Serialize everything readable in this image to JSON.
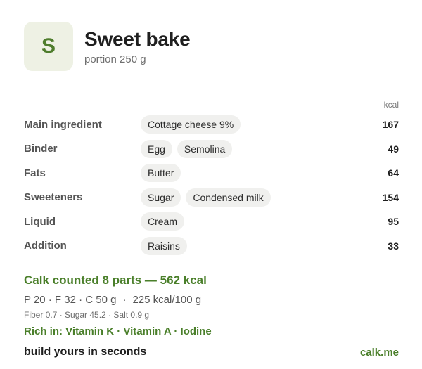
{
  "header": {
    "avatar_letter": "S",
    "title": "Sweet bake",
    "subtitle": "portion 250 g"
  },
  "table": {
    "unit_label": "kcal",
    "rows": [
      {
        "label": "Main ingredient",
        "chips": [
          "Cottage cheese 9%"
        ],
        "value": "167"
      },
      {
        "label": "Binder",
        "chips": [
          "Egg",
          "Semolina"
        ],
        "value": "49"
      },
      {
        "label": "Fats",
        "chips": [
          "Butter"
        ],
        "value": "64"
      },
      {
        "label": "Sweeteners",
        "chips": [
          "Sugar",
          "Condensed milk"
        ],
        "value": "154"
      },
      {
        "label": "Liquid",
        "chips": [
          "Cream"
        ],
        "value": "95"
      },
      {
        "label": "Addition",
        "chips": [
          "Raisins"
        ],
        "value": "33"
      }
    ]
  },
  "summary": {
    "headline": "Calk counted 8 parts — 562 kcal",
    "macros": "P 20 · F 32 · C 50 g",
    "density": "225 kcal/100 g",
    "micros": "Fiber 0.7 · Sugar 45.2 · Salt 0.9 g",
    "rich_in": "Rich in: Vitamin K · Vitamin A · Iodine"
  },
  "footer": {
    "cta": "build yours in seconds",
    "link": "calk.me"
  },
  "colors": {
    "accent": "#4a7f2a",
    "avatar_bg": "#eef1e4",
    "chip_bg": "#f0f0ee"
  }
}
